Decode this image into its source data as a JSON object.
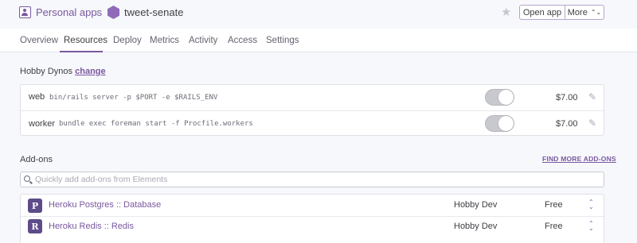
{
  "header": {
    "breadcrumb_label": "Personal apps",
    "app_name": "tweet-senate",
    "open_app_label": "Open app",
    "more_label": "More",
    "accent_color": "#79589f"
  },
  "tabs": [
    {
      "label": "Overview"
    },
    {
      "label": "Resources",
      "active": true
    },
    {
      "label": "Deploy"
    },
    {
      "label": "Metrics"
    },
    {
      "label": "Activity"
    },
    {
      "label": "Access"
    },
    {
      "label": "Settings"
    }
  ],
  "dynos": {
    "title": "Hobby Dynos",
    "change_label": "change",
    "rows": [
      {
        "type": "web",
        "command": "bin/rails server -p $PORT -e $RAILS_ENV",
        "price": "$7.00",
        "enabled": true
      },
      {
        "type": "worker",
        "command": "bundle exec foreman start -f Procfile.workers",
        "price": "$7.00",
        "enabled": true
      }
    ]
  },
  "addons": {
    "title": "Add-ons",
    "find_more_label": "FIND MORE ADD-ONS",
    "search_placeholder": "Quickly add add-ons from Elements",
    "rows": [
      {
        "name": "Heroku Postgres :: Database",
        "plan": "Hobby Dev",
        "price": "Free",
        "icon": "postgres-elephant-icon"
      },
      {
        "name": "Heroku Redis :: Redis",
        "plan": "Hobby Dev",
        "price": "Free",
        "icon": "redis-icon"
      }
    ]
  }
}
